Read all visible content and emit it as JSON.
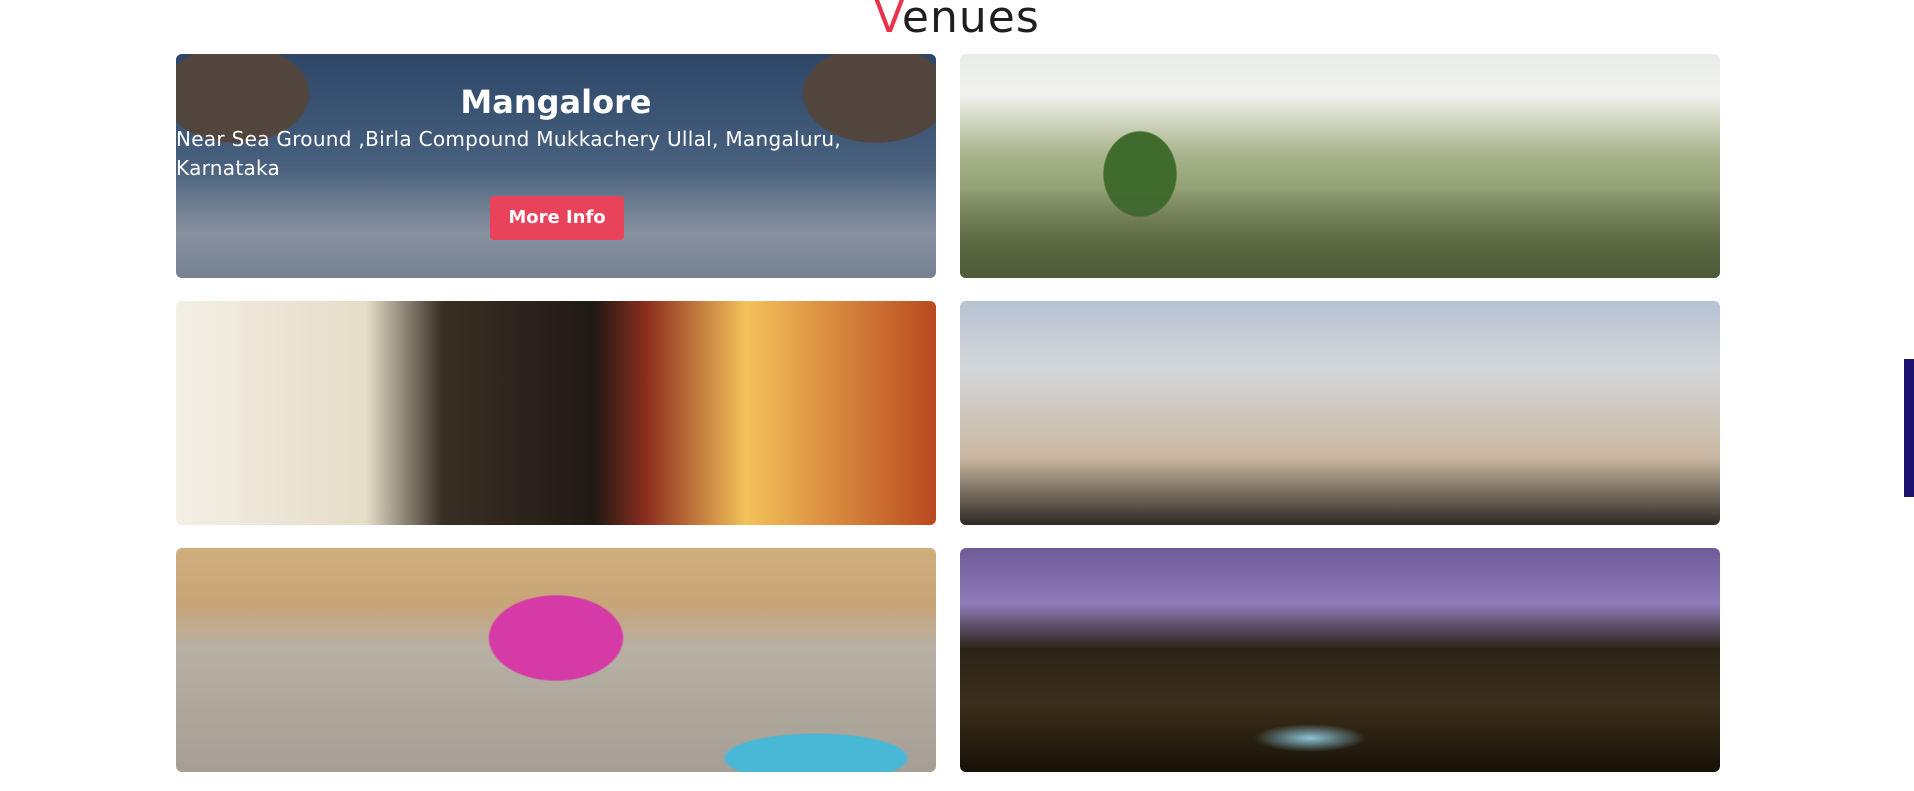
{
  "section": {
    "title_first_letter": "V",
    "title_rest": "enues"
  },
  "venues": [
    {
      "city": "Mangalore",
      "address": "Near Sea Ground ,Birla Compound Mukkachery Ullal, Mangaluru, Karnataka",
      "button_label": "More Info"
    }
  ],
  "colors": {
    "accent": "#e8334a",
    "button": "#e8435a",
    "side_tab": "#1c1470"
  }
}
